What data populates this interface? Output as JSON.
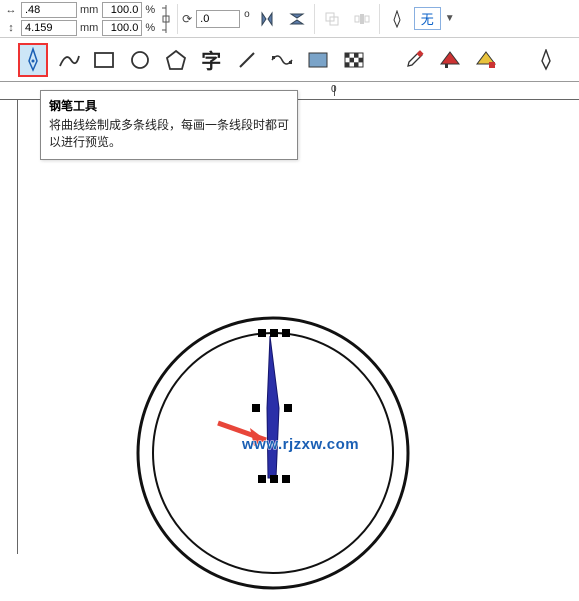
{
  "options": {
    "width_value": ".48",
    "height_value": "4.159",
    "unit": "mm",
    "scale_x": "100.0",
    "scale_y": "100.0",
    "percent": "%",
    "angle": ".0",
    "degree": "o",
    "none_label": "无"
  },
  "tooltip": {
    "title": "钢笔工具",
    "body": "将曲线绘制成多条线段，每画一条线段时都可以进行预览。"
  },
  "ruler": {
    "mark_0": "0"
  },
  "watermark": "www.rjzxw.com"
}
